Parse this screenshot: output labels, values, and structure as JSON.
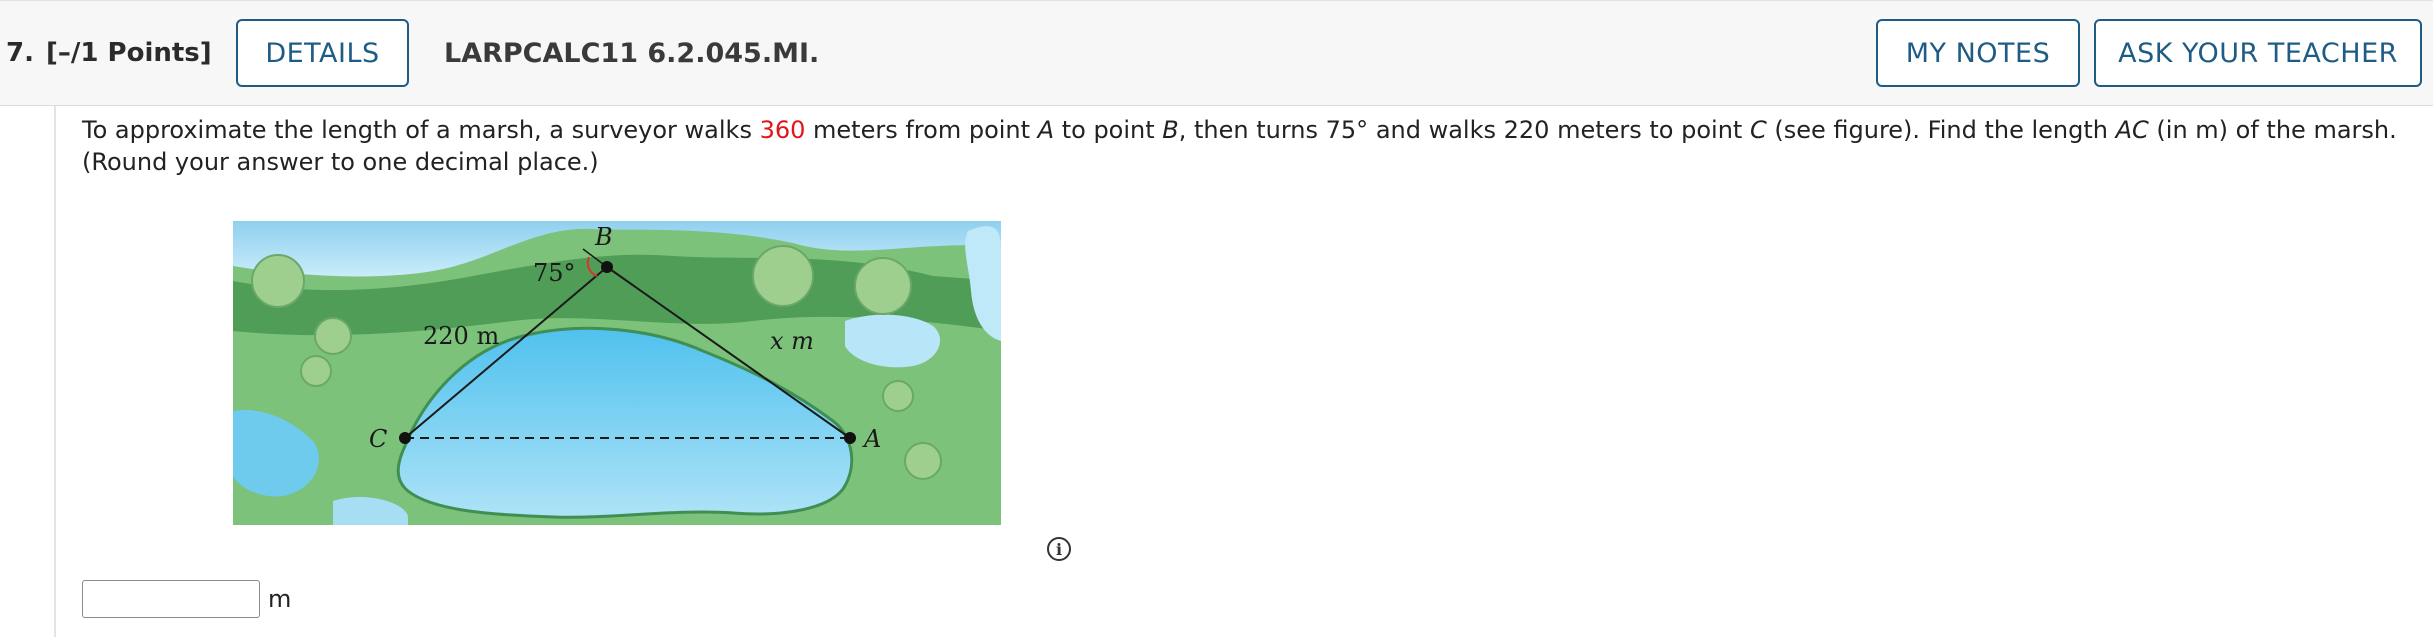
{
  "header": {
    "question_number": "7.",
    "points": "[–/1 Points]",
    "details_label": "DETAILS",
    "problem_code": "LARPCALC11 6.2.045.MI.",
    "my_notes_label": "MY NOTES",
    "ask_teacher_label": "ASK YOUR TEACHER"
  },
  "prompt": {
    "part1": "To approximate the length of a marsh, a surveyor walks ",
    "distance_ab": "360",
    "part2": " meters from point ",
    "point_a": "A",
    "part3": " to point ",
    "point_b": "B",
    "part4": ", then turns 75° and walks 220 meters to point ",
    "point_c": "C",
    "part5": " (see figure). Find the length ",
    "segment_ac": "AC",
    "part6": " (in m) of the marsh. (Round your answer to one decimal place.)"
  },
  "figure": {
    "label_b": "B",
    "label_angle": "75°",
    "label_220": "220 m",
    "label_x": "x m",
    "label_c": "C",
    "label_a": "A"
  },
  "info_icon": "i",
  "answer": {
    "value": "",
    "unit": "m"
  },
  "colors": {
    "accent_blue": "#1e5c85",
    "highlight_red": "#e0161b"
  }
}
